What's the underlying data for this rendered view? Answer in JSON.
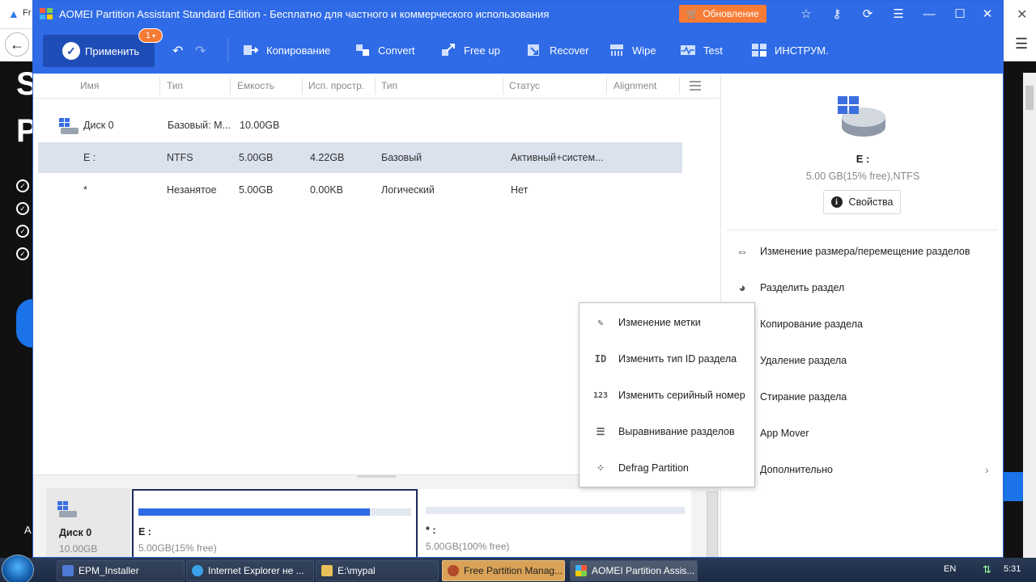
{
  "background_browser": {
    "tab_text": "Fr",
    "big_letters": [
      "S",
      "P"
    ],
    "bottom_letter": "A"
  },
  "window": {
    "title": "AOMEI Partition Assistant Standard Edition - Бесплатно для частного и коммерческого использования",
    "update_label": "Обновление"
  },
  "toolbar": {
    "apply_label": "Применить",
    "pending_count": "1",
    "tools": [
      {
        "label": "Копирование",
        "icon": "copy-icon"
      },
      {
        "label": "Convert",
        "icon": "convert-icon"
      },
      {
        "label": "Free up",
        "icon": "free-up-icon"
      },
      {
        "label": "Recover",
        "icon": "recover-icon"
      },
      {
        "label": "Wipe",
        "icon": "wipe-icon"
      },
      {
        "label": "Test",
        "icon": "test-icon"
      },
      {
        "label": "ИНСТРУМ.",
        "icon": "tools-icon"
      }
    ]
  },
  "table": {
    "headers": [
      "Имя",
      "Тип",
      "Емкость",
      "Исп. простр.",
      "Тип",
      "Статус",
      "Alignment"
    ],
    "disk_row": {
      "name": "Диск 0",
      "type": "Базовый: M...",
      "capacity": "10.00GB"
    },
    "rows": [
      {
        "name": "E :",
        "fs": "NTFS",
        "capacity": "5.00GB",
        "used": "4.22GB",
        "type": "Базовый",
        "status": "Активный+систем..."
      },
      {
        "name": "*",
        "fs": "Незанятое",
        "capacity": "5.00GB",
        "used": "0.00KB",
        "type": "Логический",
        "status": "Нет"
      }
    ]
  },
  "disk_map": {
    "disk_label": "Диск 0",
    "disk_size": "10.00GB",
    "partitions": [
      {
        "label": "E :",
        "size": "5.00GB(15% free)",
        "used_fraction": 0.85
      },
      {
        "label": "* :",
        "size": "5.00GB(100% free)",
        "used_fraction": 0
      }
    ]
  },
  "right_panel": {
    "partition_name": "E :",
    "partition_info": "5.00 GB(15% free),NTFS",
    "properties_label": "Свойства",
    "actions": [
      {
        "label": "Изменение размера/перемещение разделов",
        "icon": "resize-icon"
      },
      {
        "label": "Разделить раздел",
        "icon": "split-icon"
      },
      {
        "label": "Копирование раздела",
        "icon": "copy-partition-icon"
      },
      {
        "label": "Удаление раздела",
        "icon": "trash-icon"
      },
      {
        "label": "Стирание раздела",
        "icon": "eraser-icon"
      },
      {
        "label": "App Mover",
        "icon": "app-mover-icon"
      },
      {
        "label": "Дополнительно",
        "icon": "more-icon"
      }
    ]
  },
  "context_menu": {
    "items": [
      {
        "label": "Изменение метки",
        "icon": "pencil-icon",
        "glyph": "✎"
      },
      {
        "label": "Изменить тип ID раздела",
        "icon": "id-icon",
        "glyph": "ID"
      },
      {
        "label": "Изменить серийный номер",
        "icon": "serial-number-icon",
        "glyph": "123"
      },
      {
        "label": "Выравнивание разделов",
        "icon": "align-icon",
        "glyph": "☰"
      },
      {
        "label": "Defrag Partition",
        "icon": "defrag-icon",
        "glyph": "⁘"
      }
    ]
  },
  "taskbar": {
    "tasks": [
      "EPM_Installer",
      "Internet Explorer не ...",
      "E:\\mypal",
      "Free Partition Manag...",
      "AOMEI Partition Assis..."
    ],
    "lang": "EN",
    "time": "5:31"
  },
  "colors": {
    "brand_blue": "#2f6be6",
    "apply_blue": "#1f4db7",
    "accent_orange": "#f67b35",
    "selected_row": "#dbe2ee"
  }
}
